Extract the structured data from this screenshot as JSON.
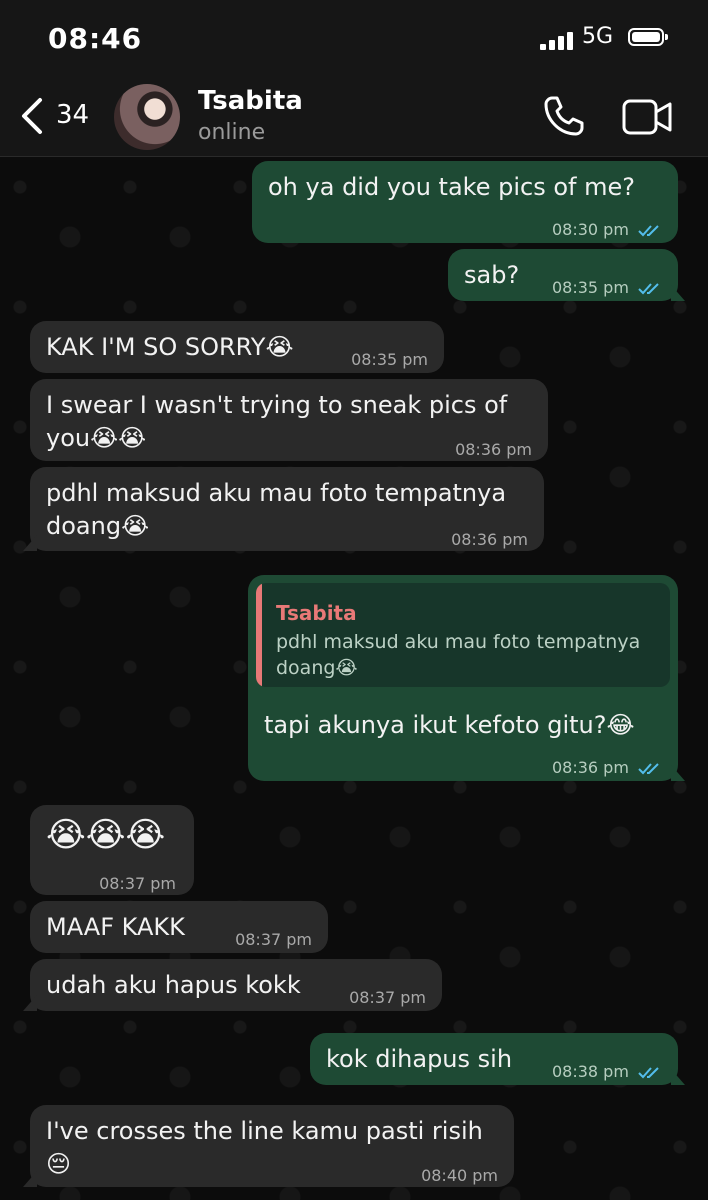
{
  "status_bar": {
    "time": "08:46",
    "network": "5G"
  },
  "header": {
    "back_count": "34",
    "contact_name": "Tsabita",
    "contact_status": "online"
  },
  "messages": [
    {
      "dir": "out",
      "text": "oh ya did you take pics of me?",
      "time": "08:30 pm"
    },
    {
      "dir": "out",
      "text": "sab?",
      "time": "08:35 pm"
    },
    {
      "dir": "in",
      "text": "KAK I'M SO SORRY😭",
      "time": "08:35 pm"
    },
    {
      "dir": "in",
      "text": "I swear I wasn't trying to sneak pics of you😭😭",
      "time": "08:36 pm"
    },
    {
      "dir": "in",
      "text": "pdhl maksud aku mau foto tempatnya doang😭",
      "time": "08:36 pm"
    },
    {
      "dir": "out",
      "quote_author": "Tsabita",
      "quote_text": "pdhl maksud aku mau foto tempatnya doang😭",
      "text": "tapi akunya ikut kefoto gitu?😂",
      "time": "08:36 pm"
    },
    {
      "dir": "in",
      "text": "😭😭😭",
      "time": "08:37 pm"
    },
    {
      "dir": "in",
      "text": "MAAF KAKK",
      "time": "08:37 pm"
    },
    {
      "dir": "in",
      "text": "udah aku hapus kokk",
      "time": "08:37 pm"
    },
    {
      "dir": "out",
      "text": "kok dihapus sih",
      "time": "08:38 pm"
    },
    {
      "dir": "in",
      "text": "I've crosses the line kamu pasti risih 😔",
      "time": "08:40 pm"
    }
  ],
  "colors": {
    "incoming": "#2a2a2a",
    "outgoing": "#1e4a34",
    "read_ticks": "#53bdeb",
    "quote_author": "#e87977"
  },
  "icons": [
    "back-chevron-icon",
    "phone-icon",
    "video-camera-icon",
    "double-check-icon"
  ]
}
